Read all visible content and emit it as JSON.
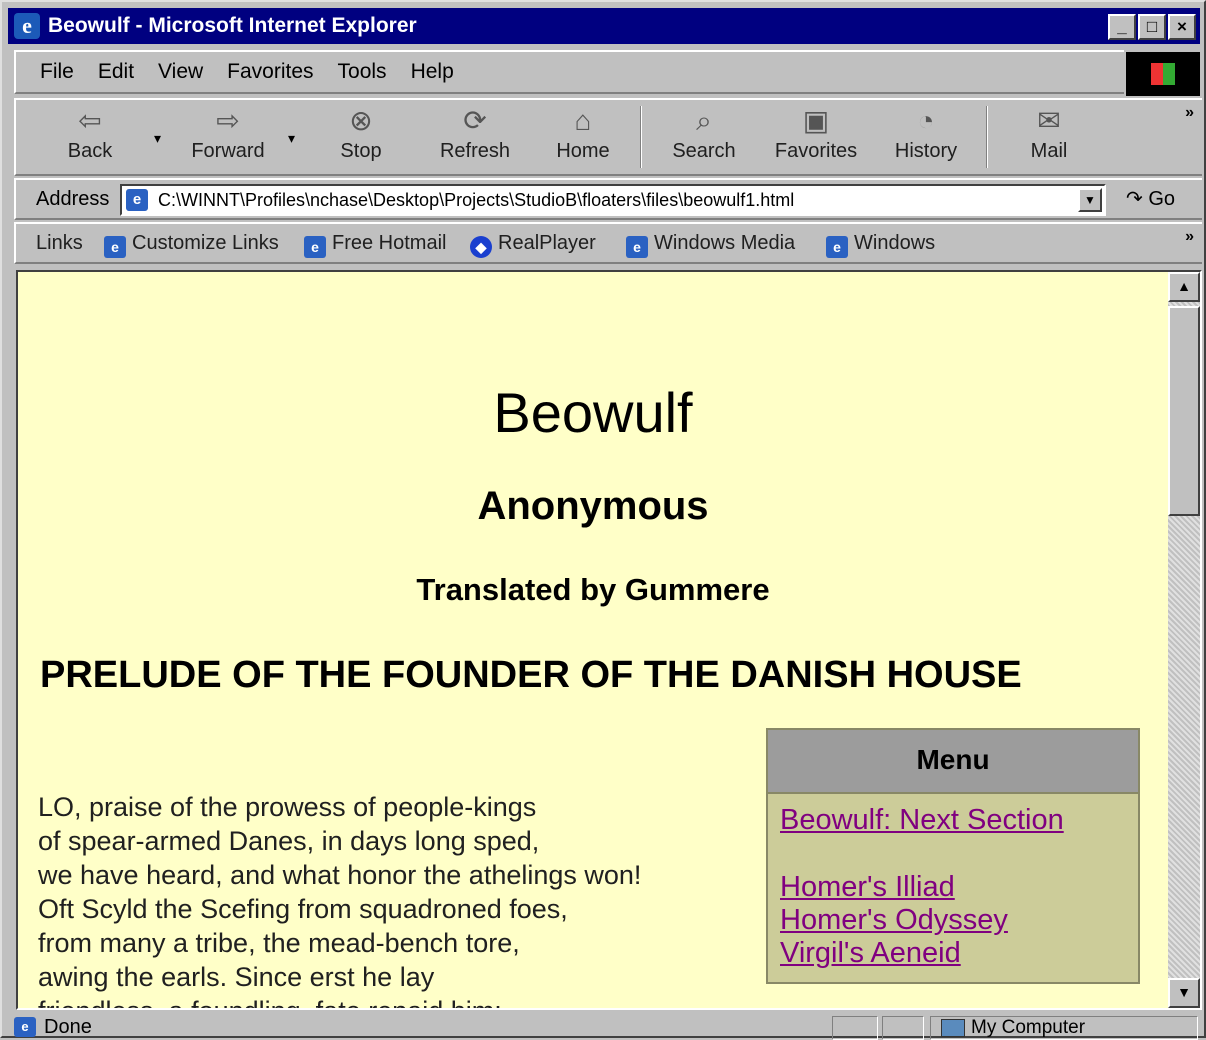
{
  "window": {
    "title": "Beowulf - Microsoft Internet Explorer"
  },
  "menubar": {
    "items": [
      "File",
      "Edit",
      "View",
      "Favorites",
      "Tools",
      "Help"
    ]
  },
  "toolbar": {
    "back": "Back",
    "forward": "Forward",
    "stop": "Stop",
    "refresh": "Refresh",
    "home": "Home",
    "search": "Search",
    "favorites": "Favorites",
    "history": "History",
    "mail": "Mail"
  },
  "address": {
    "label": "Address",
    "url": "C:\\WINNT\\Profiles\\nchase\\Desktop\\Projects\\StudioB\\floaters\\files\\beowulf1.html",
    "go": "Go"
  },
  "links": {
    "label": "Links",
    "items": [
      "Customize Links",
      "Free Hotmail",
      "RealPlayer",
      "Windows Media",
      "Windows"
    ]
  },
  "page": {
    "title": "Beowulf",
    "author": "Anonymous",
    "translator": "Translated by Gummere",
    "section_heading": "PRELUDE OF THE FOUNDER OF THE DANISH HOUSE",
    "poem_lines": [
      "LO, praise of the prowess of people-kings",
      "of spear-armed Danes, in days long sped,",
      "we have heard, and what honor the athelings won!",
      "Oft Scyld the Scefing from squadroned foes,",
      "from many a tribe, the mead-bench tore,",
      "awing the earls. Since erst he lay",
      "friendless, a foundling, fate repaid him:"
    ],
    "menu": {
      "heading": "Menu",
      "links": [
        "Beowulf: Next Section",
        "Homer's Illiad",
        "Homer's Odyssey",
        "Virgil's Aeneid"
      ]
    }
  },
  "status": {
    "text": "Done",
    "zone": "My Computer"
  }
}
